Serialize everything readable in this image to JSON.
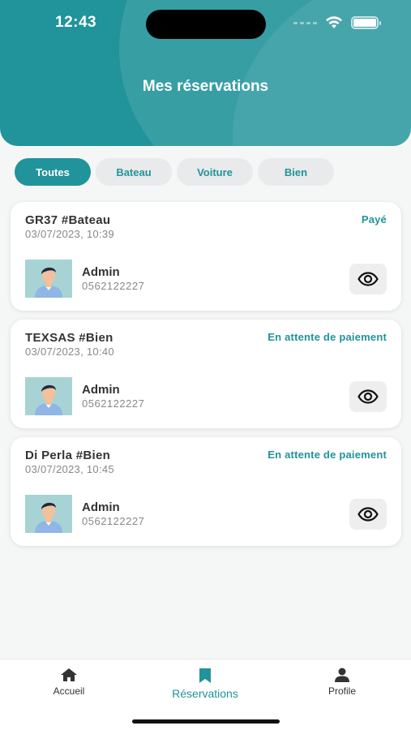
{
  "status_bar": {
    "time": "12:43"
  },
  "header": {
    "title": "Mes réservations"
  },
  "filters": [
    {
      "label": "Toutes",
      "active": true
    },
    {
      "label": "Bateau",
      "active": false
    },
    {
      "label": "Voiture",
      "active": false
    },
    {
      "label": "Bien",
      "active": false
    }
  ],
  "reservations": [
    {
      "title": "GR37 #Bateau",
      "date": "03/07/2023, 10:39",
      "status": "Payé",
      "user_name": "Admin",
      "phone": "0562122227"
    },
    {
      "title": "TEXSAS #Bien",
      "date": "03/07/2023, 10:40",
      "status": "En attente de paiement",
      "user_name": "Admin",
      "phone": "0562122227"
    },
    {
      "title": "Di Perla #Bien",
      "date": "03/07/2023, 10:45",
      "status": "En attente de paiement",
      "user_name": "Admin",
      "phone": "0562122227"
    }
  ],
  "bottom_nav": [
    {
      "label": "Accueil",
      "icon": "home-icon",
      "active": false
    },
    {
      "label": "Réservations",
      "icon": "bookmark-icon",
      "active": true
    },
    {
      "label": "Profile",
      "icon": "person-icon",
      "active": false
    }
  ],
  "colors": {
    "accent": "#21939a",
    "background": "#f5f6f6",
    "card": "#ffffff"
  }
}
